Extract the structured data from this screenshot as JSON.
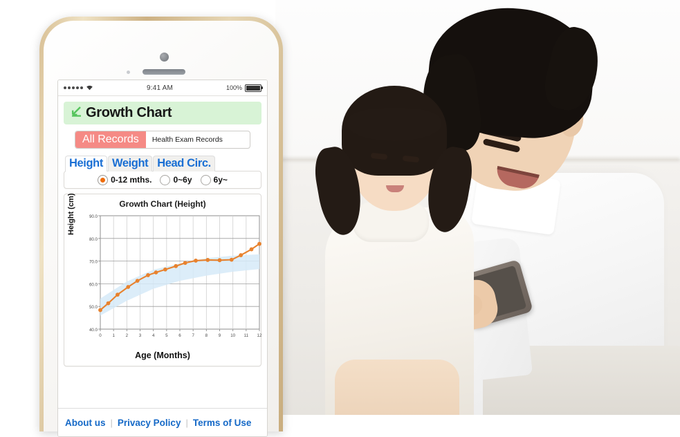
{
  "statusbar": {
    "signal_icon": "signal-dots",
    "wifi_icon": "wifi-icon",
    "time": "9:41 AM",
    "battery_percent": "100%",
    "battery_icon": "battery-full-icon"
  },
  "header": {
    "icon": "trend-arrow-down-left-icon",
    "title": "Growth Chart"
  },
  "segmented": {
    "selected": "All Records",
    "options": [
      "All Records",
      "Health Exam Records"
    ],
    "unselected": "Health Exam Records",
    "active_color": "#f58a85"
  },
  "tabs": [
    {
      "label": "Height",
      "active": true
    },
    {
      "label": "Weight",
      "active": false
    },
    {
      "label": "Head Circ.",
      "active": false
    }
  ],
  "tab_labels": {
    "height": "Height",
    "weight": "Weight",
    "head": "Head Circ."
  },
  "age_ranges": {
    "selected": "0-12 mths.",
    "options": [
      "0-12 mths.",
      "0~6y",
      "6y~"
    ],
    "o1": "0-12 mths.",
    "o2": "0~6y",
    "o3": "6y~",
    "accent_color": "#ef6c0a"
  },
  "footer": {
    "about": "About us",
    "privacy": "Privacy Policy",
    "terms": "Terms of Use",
    "separator": "|"
  },
  "photo": {
    "description": "father and daughter looking at a smartphone"
  },
  "chart_data": {
    "type": "line",
    "title": "Growth Chart (Height)",
    "xlabel": "Age (Months)",
    "ylabel": "Height (cm)",
    "xlim": [
      0,
      12
    ],
    "ylim": [
      40.0,
      90.0
    ],
    "xticks": [
      0,
      1,
      2,
      3,
      4,
      5,
      6,
      7,
      8,
      9,
      10,
      11,
      12
    ],
    "xtick_labels": [
      "0",
      "1",
      "2",
      "3",
      "4",
      "5",
      "6",
      "7",
      "8",
      "9",
      "10",
      "11",
      "12"
    ],
    "yticks": [
      40.0,
      50.0,
      60.0,
      70.0,
      80.0,
      90.0
    ],
    "ytick_labels": [
      "40.0",
      "50.0",
      "60.0",
      "70.0",
      "80.0",
      "90.0"
    ],
    "grid": true,
    "legend": "none",
    "line_color": "#e8822e",
    "band_color": "#d6eaf8",
    "series": [
      {
        "name": "Height",
        "x": [
          0,
          0.6,
          1.3,
          2.1,
          2.8,
          3.6,
          4.2,
          4.9,
          5.7,
          6.4,
          7.2,
          8.1,
          9.0,
          9.9,
          10.6,
          11.4,
          12.0
        ],
        "values": [
          48.4,
          51.4,
          55.2,
          58.6,
          61.3,
          63.8,
          65.0,
          66.3,
          67.8,
          69.2,
          70.2,
          70.5,
          70.4,
          70.6,
          72.6,
          75.2,
          77.6
        ]
      }
    ],
    "reference_band": {
      "name": "normal range",
      "x": [
        0,
        2,
        4,
        6,
        8,
        10,
        12
      ],
      "upper": [
        53.5,
        61.0,
        66.2,
        69.0,
        71.3,
        72.4,
        73.0
      ],
      "lower": [
        46.0,
        52.5,
        57.8,
        61.3,
        63.6,
        65.3,
        66.5
      ]
    }
  }
}
